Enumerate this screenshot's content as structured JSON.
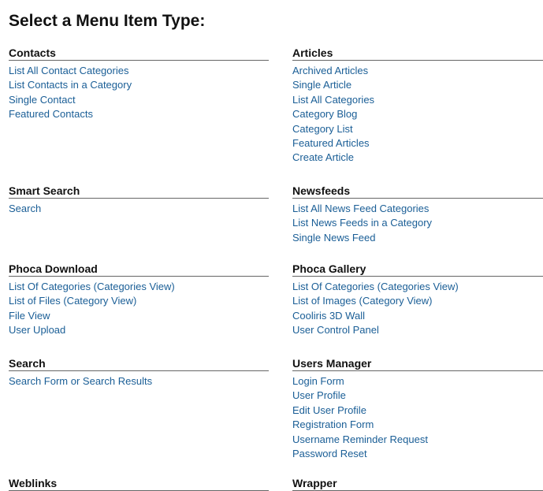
{
  "title": "Select a Menu Item Type:",
  "groups": [
    {
      "name": "Contacts",
      "items": [
        "List All Contact Categories",
        "List Contacts in a Category",
        "Single Contact",
        "Featured Contacts"
      ]
    },
    {
      "name": "Articles",
      "items": [
        "Archived Articles",
        "Single Article",
        "List All Categories",
        "Category Blog",
        "Category List",
        "Featured Articles",
        "Create Article"
      ]
    },
    {
      "name": "Smart Search",
      "items": [
        "Search"
      ]
    },
    {
      "name": "Newsfeeds",
      "items": [
        "List All News Feed Categories",
        "List News Feeds in a Category",
        "Single News Feed"
      ]
    },
    {
      "name": "Phoca Download",
      "items": [
        "List Of Categories (Categories View)",
        "List of Files (Category View)",
        "File View",
        "User Upload"
      ]
    },
    {
      "name": "Phoca Gallery",
      "items": [
        "List Of Categories (Categories View)",
        "List of Images (Category View)",
        "Cooliris 3D Wall",
        "User Control Panel"
      ]
    },
    {
      "name": "Search",
      "items": [
        "Search Form or Search Results"
      ]
    },
    {
      "name": "Users Manager",
      "items": [
        "Login Form",
        "User Profile",
        "Edit User Profile",
        "Registration Form",
        "Username Reminder Request",
        "Password Reset"
      ]
    },
    {
      "name": "Weblinks",
      "items": []
    },
    {
      "name": "Wrapper",
      "items": []
    }
  ]
}
